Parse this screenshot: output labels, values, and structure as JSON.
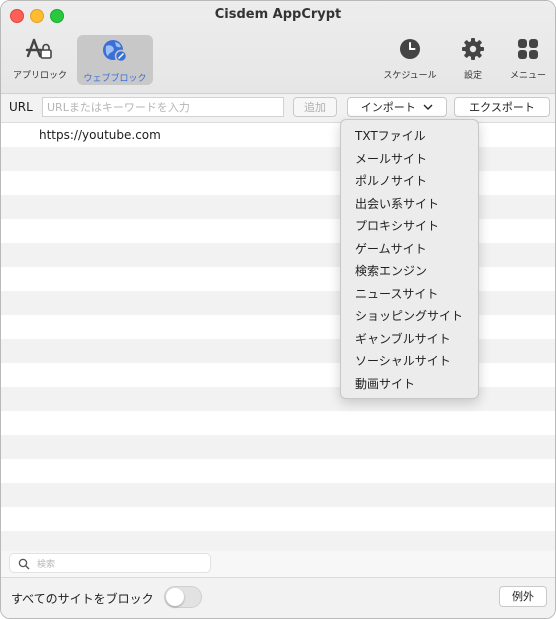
{
  "window": {
    "title": "Cisdem AppCrypt"
  },
  "toolbar": {
    "app_lock": "アプリロック",
    "web_block": "ウェブブロック",
    "schedule": "スケジュール",
    "settings": "設定",
    "menu": "メニュー"
  },
  "url_bar": {
    "label": "URL",
    "placeholder": "URLまたはキーワードを入力",
    "add": "追加",
    "import": "インポート",
    "export": "エクスポート"
  },
  "sites": [
    "https://youtube.com",
    "",
    "",
    "",
    "",
    "",
    "",
    "",
    "",
    "",
    "",
    "",
    "",
    "",
    "",
    "",
    "",
    ""
  ],
  "import_menu": [
    "TXTファイル",
    "メールサイト",
    "ポルノサイト",
    "出会い系サイト",
    "プロキシサイト",
    "ゲームサイト",
    "検索エンジン",
    "ニュースサイト",
    "ショッピングサイト",
    "ギャンブルサイト",
    "ソーシャルサイト",
    "動画サイト"
  ],
  "search": {
    "placeholder": "検索"
  },
  "footer": {
    "block_all": "すべてのサイトをブロック",
    "block_all_on": false,
    "exceptions": "例外"
  },
  "colors": {
    "accent": "#3b6fd8",
    "close": "#fe5f57",
    "minimize": "#febc2e",
    "maximize": "#28c840"
  }
}
